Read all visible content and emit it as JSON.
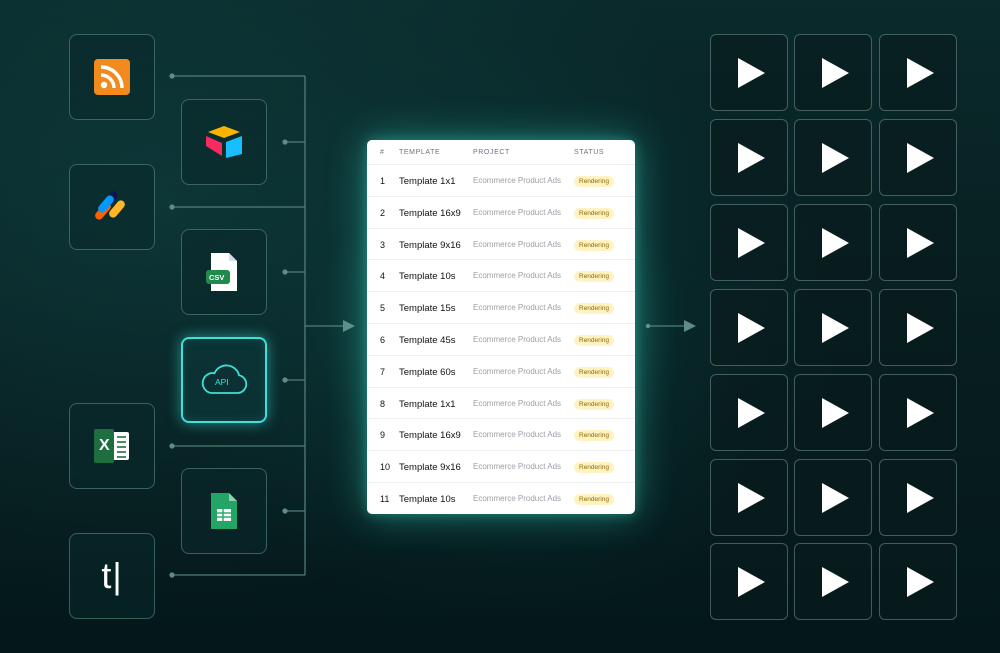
{
  "sources": [
    {
      "name": "rss-icon"
    },
    {
      "name": "airtable-icon"
    },
    {
      "name": "jotform-icon"
    },
    {
      "name": "csv-file-icon",
      "label": "CSV"
    },
    {
      "name": "api-cloud-icon",
      "label": "API",
      "active": true
    },
    {
      "name": "excel-icon",
      "label": "X"
    },
    {
      "name": "google-sheets-icon"
    },
    {
      "name": "typeform-icon",
      "label": "t|"
    }
  ],
  "table": {
    "headers": [
      "#",
      "TEMPLATE",
      "PROJECT",
      "STATUS"
    ],
    "rows": [
      {
        "num": "1",
        "template": "Template 1x1",
        "project": "Ecommerce Product Ads",
        "status": "Rendering"
      },
      {
        "num": "2",
        "template": "Template 16x9",
        "project": "Ecommerce Product Ads",
        "status": "Rendering"
      },
      {
        "num": "3",
        "template": "Template 9x16",
        "project": "Ecommerce Product Ads",
        "status": "Rendering"
      },
      {
        "num": "4",
        "template": "Template 10s",
        "project": "Ecommerce Product Ads",
        "status": "Rendering"
      },
      {
        "num": "5",
        "template": "Template 15s",
        "project": "Ecommerce Product Ads",
        "status": "Rendering"
      },
      {
        "num": "6",
        "template": "Template 45s",
        "project": "Ecommerce Product Ads",
        "status": "Rendering"
      },
      {
        "num": "7",
        "template": "Template 60s",
        "project": "Ecommerce Product Ads",
        "status": "Rendering"
      },
      {
        "num": "8",
        "template": "Template 1x1",
        "project": "Ecommerce Product Ads",
        "status": "Rendering"
      },
      {
        "num": "9",
        "template": "Template 16x9",
        "project": "Ecommerce Product Ads",
        "status": "Rendering"
      },
      {
        "num": "10",
        "template": "Template 9x16",
        "project": "Ecommerce Product Ads",
        "status": "Rendering"
      },
      {
        "num": "11",
        "template": "Template 10s",
        "project": "Ecommerce Product Ads",
        "status": "Rendering"
      }
    ]
  },
  "outputs": {
    "rows": 7,
    "cols": 3,
    "icon": "play-icon"
  },
  "colors": {
    "accent": "#3fe0d8",
    "connector": "#5f8c88",
    "status_bg": "#fff3c4",
    "status_text": "#8a6d00",
    "rss": "#f38a1d",
    "excel": "#1d6f42",
    "sheets": "#23a566"
  }
}
